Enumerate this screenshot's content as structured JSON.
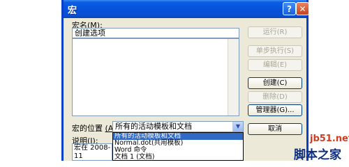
{
  "window": {
    "title": "宏",
    "help": "?",
    "close": "✕"
  },
  "macro_name": {
    "label": "宏名",
    "hotkey": "(M):",
    "value": "创建选项"
  },
  "buttons": {
    "run": "运行(R)",
    "step": "单步执行(S)",
    "edit": "编辑(E)",
    "create": "创建(C)",
    "delete": "删除(D)",
    "organizer": "管理器(G)...",
    "cancel": "取消"
  },
  "location": {
    "label": "宏的位置",
    "hotkey": "(A)",
    "selected": "所有的活动模板和文档",
    "options": [
      "所有的活动模板和文档",
      "Normal.dot(共用模板)",
      "Word 命令",
      "文档 1 (文档)"
    ]
  },
  "description": {
    "label": "说明",
    "hotkey": "(I):",
    "value": "宏在 2008-11"
  },
  "watermark": {
    "site": "jb51.net",
    "name": "脚本之家"
  }
}
